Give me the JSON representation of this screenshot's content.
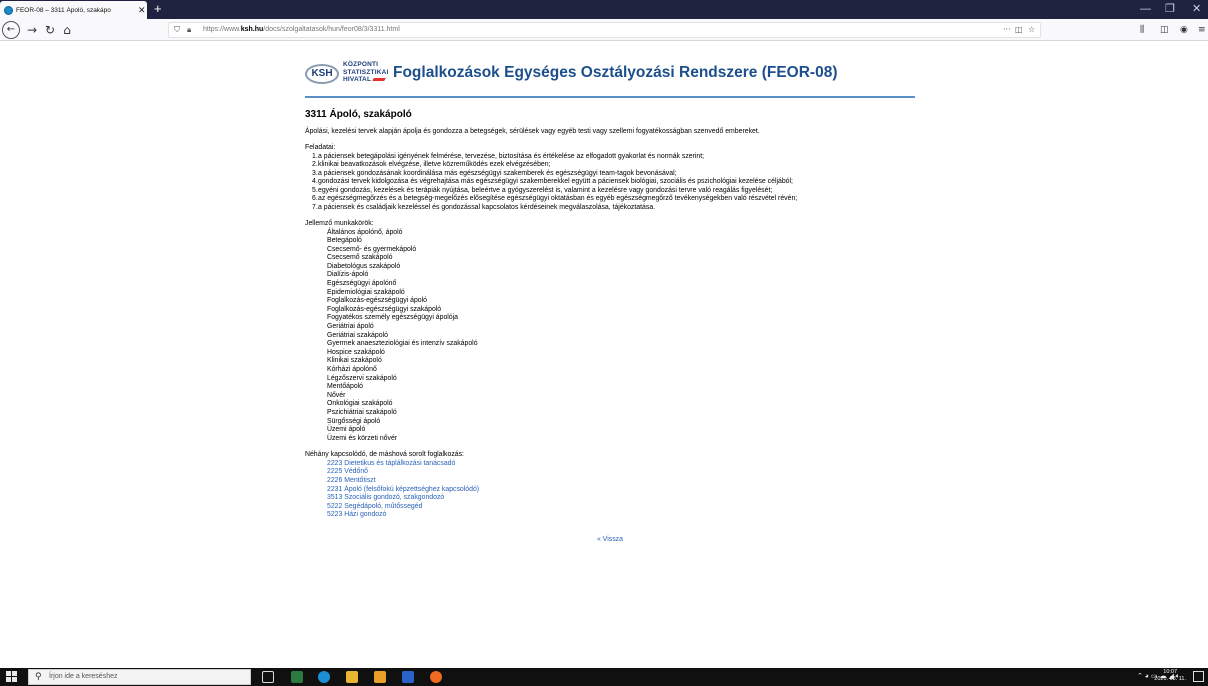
{
  "browser": {
    "tab_title": "FEOR-08 – 3311 Ápoló, szakápo",
    "url_prefix": "https://www.",
    "url_domain": "ksh.hu",
    "url_path": "/docs/szolgaltatasok/hun/feor08/3/3311.html"
  },
  "header": {
    "logo_abbr": "KSH",
    "logo_line1": "KÖZPONTI",
    "logo_line2": "STATISZTIKAI",
    "logo_line3": "HIVATAL",
    "site_title": "Foglalkozások Egységes Osztályozási Rendszere (FEOR-08)"
  },
  "page": {
    "title": "3311 Ápoló, szakápoló",
    "intro": "Ápolási, kezelési tervek alapján ápolja és gondozza a betegségek, sérülések vagy egyéb testi vagy szellemi fogyatékosságban szenvedő embereket.",
    "tasks_label": "Feladatai:",
    "tasks": [
      "a páciensek betegápolási igényének felmérése, tervezése, biztosítása és értékelése az elfogadott gyakorlat és normák szerint;",
      "klinikai beavatkozások elvégzése, illetve közreműködés ezek elvégzésében;",
      "a páciensek gondozásának koordinálása más egészségügyi szakemberek és egészségügyi team-tagok bevonásával;",
      "gondozási tervek kidolgozása és végrehajtása más egészségügyi szakemberekkel együtt a páciensek biológiai, szociális és pszichológiai kezelése céljából;",
      "egyéni gondozás, kezelések és terápiák nyújtása, beleértve a gyógyszerelést is, valamint a kezelésre vagy gondozási tervre való reagálás figyelését;",
      "az egészségmegőrzés és a betegség-megelőzés elősegítése egészségügyi oktatásban és egyéb egészségmegőrző tevékenységekben való részvétel révén;",
      "a páciensek és családjaik kezeléssel és gondozással kapcsolatos kérdéseinek megválaszolása, tájékoztatása."
    ],
    "task_numbers": [
      "1.",
      "2.",
      "3.",
      "4.",
      "5.",
      "6.",
      "7."
    ],
    "jobs_label": "Jellemző munkakörök:",
    "jobs": [
      "Általános ápolónő, ápoló",
      "Betegápoló",
      "Csecsemő- és gyermekápoló",
      "Csecsemő szakápoló",
      "Diabetológus szakápoló",
      "Dialízis-ápoló",
      "Egészségügyi ápolónő",
      "Epidemiológiai szakápoló",
      "Foglalkozás-egészségügyi ápoló",
      "Foglalkozás-egészségügyi szakápoló",
      "Fogyatékos személy egészségügyi ápolója",
      "Geriátriai ápoló",
      "Geriátriai szakápoló",
      "Gyermek anaeszteziológiai és intenzív szakápoló",
      "Hospice szakápoló",
      "Klinikai szakápoló",
      "Kórházi ápolónő",
      "Légzőszervi szakápoló",
      "Mentőápoló",
      "Nővér",
      "Onkológiai szakápoló",
      "Pszichiátriai szakápoló",
      "Sürgősségi ápoló",
      "Üzemi ápoló",
      "Üzemi és körzeti nővér"
    ],
    "related_label": "Néhány kapcsolódó, de máshová sorolt foglalkozás:",
    "related": [
      "2223 Dietetikus és táplálkozási tanácsadó",
      "2225 Védőnő",
      "2226 Mentőtiszt",
      "2231 Ápoló (felsőfokú képzettséghez kapcsolódó)",
      "3513 Szociális gondozó, szakgondozó",
      "5222 Segédápoló, műtőssegéd",
      "5223 Házi gondozó"
    ],
    "back_link": "« Vissza"
  },
  "taskbar": {
    "search_placeholder": "Írjon ide a kereséshez",
    "clock_time": "10:07",
    "clock_date": "2020. 08. 11."
  },
  "colors": {
    "link": "#2962b8",
    "header_rule": "#5b8fc7",
    "tabbar": "#202340",
    "taskbar": "#101010"
  }
}
